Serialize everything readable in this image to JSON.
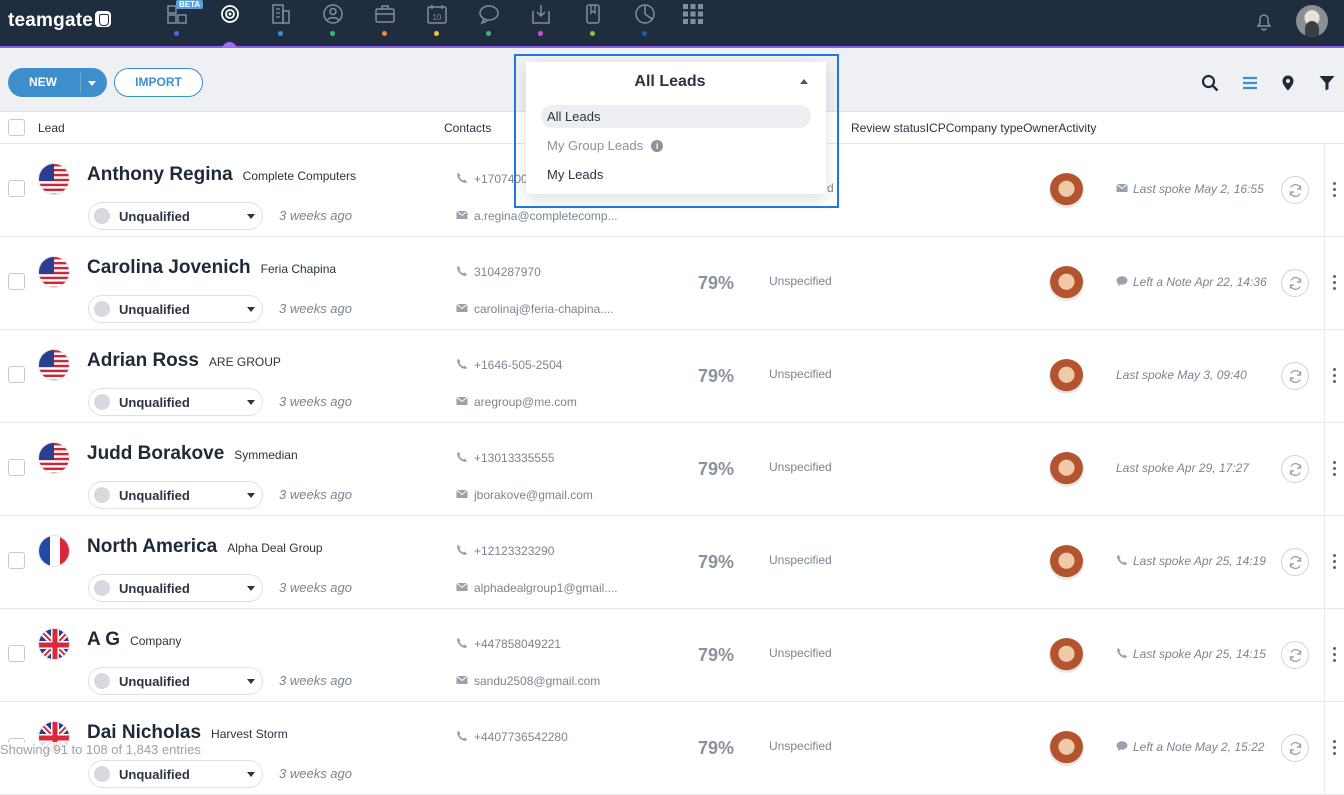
{
  "app": {
    "logo_text": "teamgate",
    "beta_badge": "BETA",
    "nav_icons": [
      "dashboard-icon",
      "leads-target-icon",
      "companies-building-icon",
      "contacts-person-icon",
      "deals-briefcase-icon",
      "calendar-icon",
      "chat-icon",
      "inbox-icon",
      "documents-icon",
      "reports-pie-icon",
      "apps-grid-icon"
    ],
    "nav_dot_colors": [
      "#4b6de0",
      "#8a5cf5",
      "#3d8fcb",
      "#2fbf71",
      "#f08a3c",
      "#e6c73a",
      "#2fbf71",
      "#c055d8",
      "#8cc63f",
      "#1f5fb0"
    ],
    "accent_color": "#8a5cf5"
  },
  "toolbar": {
    "new_label": "NEW",
    "import_label": "IMPORT"
  },
  "view_dropdown": {
    "title": "All Leads",
    "options": [
      {
        "label": "All Leads",
        "selected": true
      },
      {
        "label": "My Group Leads",
        "info": "i"
      },
      {
        "label": "My Leads"
      }
    ]
  },
  "table": {
    "headers": {
      "lead": "Lead",
      "contacts": "Contacts",
      "rest": "Review statusICPCompany typeOwnerActivity"
    },
    "rows": [
      {
        "name": "Anthony Regina",
        "company": "Complete Computers",
        "flag": "us",
        "status": "Unqualified",
        "ago": "3 weeks ago",
        "phone": "+17074007",
        "email": "a.regina@completecomp...",
        "score": "",
        "company_type": "d",
        "activity_icon": "email-icon",
        "activity": "Last spoke May 2, 16:55"
      },
      {
        "name": "Carolina Jovenich",
        "company": "Feria Chapina",
        "flag": "us",
        "status": "Unqualified",
        "ago": "3 weeks ago",
        "phone": "3104287970",
        "email": "carolinaj@feria-chapina....",
        "score": "79%",
        "company_type": "Unspecified",
        "activity_icon": "note-icon",
        "activity": "Left a Note Apr 22, 14:36"
      },
      {
        "name": "Adrian Ross",
        "company": "ARE GROUP",
        "flag": "us",
        "status": "Unqualified",
        "ago": "3 weeks ago",
        "phone": "+1646-505-2504",
        "email": "aregroup@me.com",
        "score": "79%",
        "company_type": "Unspecified",
        "activity_icon": "",
        "activity": "Last spoke May 3, 09:40"
      },
      {
        "name": "Judd Borakove",
        "company": "Symmedian",
        "flag": "us",
        "status": "Unqualified",
        "ago": "3 weeks ago",
        "phone": "+13013335555",
        "email": "jborakove@gmail.com",
        "score": "79%",
        "company_type": "Unspecified",
        "activity_icon": "",
        "activity": "Last spoke Apr 29, 17:27"
      },
      {
        "name": "North America",
        "company": "Alpha Deal Group",
        "flag": "fr",
        "status": "Unqualified",
        "ago": "3 weeks ago",
        "phone": "+12123323290",
        "email": "alphadealgroup1@gmail....",
        "score": "79%",
        "company_type": "Unspecified",
        "activity_icon": "phone-icon",
        "activity": "Last spoke Apr 25, 14:19"
      },
      {
        "name": "A G",
        "company": "Company",
        "flag": "uk",
        "status": "Unqualified",
        "ago": "3 weeks ago",
        "phone": "+447858049221",
        "email": "sandu2508@gmail.com",
        "score": "79%",
        "company_type": "Unspecified",
        "activity_icon": "phone-icon",
        "activity": "Last spoke Apr 25, 14:15"
      },
      {
        "name": "Dai Nicholas",
        "company": "Harvest Storm",
        "flag": "uk",
        "status": "Unqualified",
        "ago": "3 weeks ago",
        "phone": "+4407736542280",
        "email": "",
        "score": "79%",
        "company_type": "Unspecified",
        "activity_icon": "note-icon",
        "activity": "Left a Note May 2, 15:22"
      }
    ]
  },
  "footer": {
    "entries_text": "Showing 91 to 108 of 1,843 entries"
  }
}
